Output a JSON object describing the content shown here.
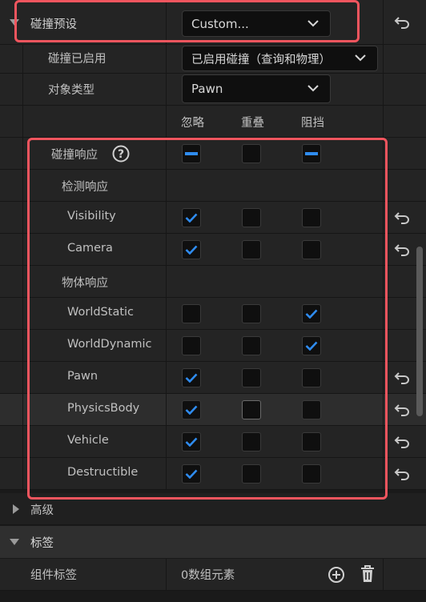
{
  "preset": {
    "label": "碰撞预设",
    "value": "Custom..."
  },
  "enabled": {
    "label": "碰撞已启用",
    "value": "已启用碰撞（查询和物理）"
  },
  "object_type": {
    "label": "对象类型",
    "value": "Pawn"
  },
  "columns": {
    "ignore": "忽略",
    "overlap": "重叠",
    "block": "阻挡"
  },
  "responses": {
    "label": "碰撞响应",
    "help_icon": "question-circle-icon",
    "ignore_state": "mixed",
    "overlap_state": "unchecked",
    "block_state": "mixed"
  },
  "trace": {
    "label": "检测响应",
    "rows": [
      {
        "name": "Visibility",
        "ignore": true,
        "overlap": false,
        "block": false,
        "reset": true
      },
      {
        "name": "Camera",
        "ignore": true,
        "overlap": false,
        "block": false,
        "reset": true
      }
    ]
  },
  "object": {
    "label": "物体响应",
    "rows": [
      {
        "name": "WorldStatic",
        "ignore": false,
        "overlap": false,
        "block": true,
        "reset": false
      },
      {
        "name": "WorldDynamic",
        "ignore": false,
        "overlap": false,
        "block": true,
        "reset": false
      },
      {
        "name": "Pawn",
        "ignore": true,
        "overlap": false,
        "block": false,
        "reset": true
      },
      {
        "name": "PhysicsBody",
        "ignore": true,
        "overlap": false,
        "block": false,
        "reset": true
      },
      {
        "name": "Vehicle",
        "ignore": true,
        "overlap": false,
        "block": false,
        "reset": true
      },
      {
        "name": "Destructible",
        "ignore": true,
        "overlap": false,
        "block": false,
        "reset": true
      }
    ]
  },
  "advanced": {
    "label": "高级"
  },
  "tags": {
    "label": "标签"
  },
  "component_tags": {
    "label": "组件标签",
    "value": "0数组元素",
    "add_icon": "plus-circle-icon",
    "delete_icon": "trash-icon"
  },
  "colors": {
    "accent": "#2f8cf0",
    "highlight": "#f2555e"
  }
}
